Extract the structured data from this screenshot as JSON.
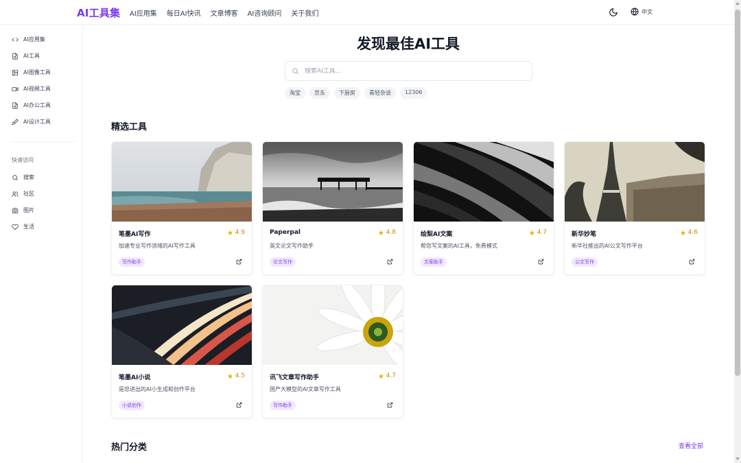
{
  "brand": "AI工具集",
  "nav": [
    "AI应用集",
    "每日AI快讯",
    "文章博客",
    "AI咨询顾问",
    "关于我们"
  ],
  "language": "中文",
  "sidebar": {
    "items": [
      {
        "label": "AI应用集",
        "icon": "code-icon"
      },
      {
        "label": "AI工具",
        "icon": "document-icon"
      },
      {
        "label": "AI图像工具",
        "icon": "image-icon"
      },
      {
        "label": "AI视频工具",
        "icon": "video-icon"
      },
      {
        "label": "AI办公工具",
        "icon": "document-icon"
      },
      {
        "label": "AI设计工具",
        "icon": "brush-icon"
      }
    ],
    "quick_title": "快速访问",
    "quick_items": [
      {
        "label": "搜索",
        "icon": "search-icon"
      },
      {
        "label": "社区",
        "icon": "users-icon"
      },
      {
        "label": "图片",
        "icon": "camera-icon"
      },
      {
        "label": "生活",
        "icon": "heart-icon"
      }
    ]
  },
  "hero": {
    "title": "发现最佳AI工具",
    "search_placeholder": "搜索AI工具...",
    "tags": [
      "淘宝",
      "京东",
      "下厨房",
      "青轻杂谈",
      "12306"
    ]
  },
  "featured": {
    "title": "精选工具",
    "cards": [
      {
        "name": "笔墨AI写作",
        "rating": "4.9",
        "desc": "加速专业写作领域的AI写作工具",
        "tag": "写作助手",
        "image": "coastal-cliffs"
      },
      {
        "name": "Paperpal",
        "rating": "4.8",
        "desc": "英文论文写作助手",
        "tag": "论文写作",
        "image": "pier-bw"
      },
      {
        "name": "绘梨AI文案",
        "rating": "4.7",
        "desc": "帮您写文案的AI工具，免费模式",
        "tag": "文案助手",
        "image": "abstract-architecture"
      },
      {
        "name": "新华妙笔",
        "rating": "4.6",
        "desc": "新华社推出的AI公文写作平台",
        "tag": "公文写作",
        "image": "eiffel-tower"
      },
      {
        "name": "笔墨AI小说",
        "rating": "4.5",
        "desc": "是您进出的AI小生成和创作平台",
        "tag": "小说创作",
        "image": "light-trails"
      },
      {
        "name": "讯飞文章写作助手",
        "rating": "4.7",
        "desc": "国产大模型的AI文章写作工具",
        "tag": "写作助手",
        "image": "daisy"
      }
    ]
  },
  "hot": {
    "title": "热门分类",
    "view_all": "查看全部"
  },
  "colors": {
    "accent": "#7c3aed",
    "star": "#eab308"
  }
}
